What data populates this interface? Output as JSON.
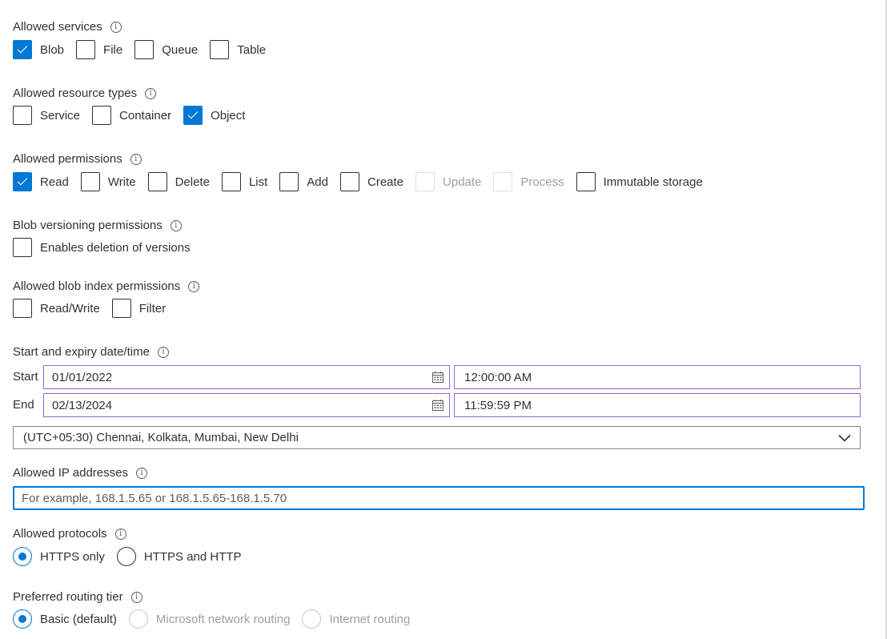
{
  "info_glyph": "i",
  "allowed_services": {
    "label": "Allowed services",
    "options": [
      {
        "label": "Blob",
        "checked": true
      },
      {
        "label": "File",
        "checked": false
      },
      {
        "label": "Queue",
        "checked": false
      },
      {
        "label": "Table",
        "checked": false
      }
    ]
  },
  "allowed_resource_types": {
    "label": "Allowed resource types",
    "options": [
      {
        "label": "Service",
        "checked": false
      },
      {
        "label": "Container",
        "checked": false
      },
      {
        "label": "Object",
        "checked": true
      }
    ]
  },
  "allowed_permissions": {
    "label": "Allowed permissions",
    "options": [
      {
        "label": "Read",
        "checked": true
      },
      {
        "label": "Write",
        "checked": false
      },
      {
        "label": "Delete",
        "checked": false
      },
      {
        "label": "List",
        "checked": false
      },
      {
        "label": "Add",
        "checked": false
      },
      {
        "label": "Create",
        "checked": false
      },
      {
        "label": "Update",
        "checked": false,
        "disabled": true
      },
      {
        "label": "Process",
        "checked": false,
        "disabled": true
      },
      {
        "label": "Immutable storage",
        "checked": false
      }
    ]
  },
  "blob_versioning": {
    "label": "Blob versioning permissions",
    "options": [
      {
        "label": "Enables deletion of versions",
        "checked": false
      }
    ]
  },
  "blob_index": {
    "label": "Allowed blob index permissions",
    "options": [
      {
        "label": "Read/Write",
        "checked": false
      },
      {
        "label": "Filter",
        "checked": false
      }
    ]
  },
  "datetime": {
    "label": "Start and expiry date/time",
    "start_label": "Start",
    "end_label": "End",
    "start_date": "01/01/2022",
    "start_time": "12:00:00 AM",
    "end_date": "02/13/2024",
    "end_time": "11:59:59 PM",
    "timezone": "(UTC+05:30) Chennai, Kolkata, Mumbai, New Delhi"
  },
  "ip": {
    "label": "Allowed IP addresses",
    "value": "",
    "placeholder": "For example, 168.1.5.65 or 168.1.5.65-168.1.5.70"
  },
  "protocols": {
    "label": "Allowed protocols",
    "options": [
      {
        "label": "HTTPS only",
        "selected": true
      },
      {
        "label": "HTTPS and HTTP",
        "selected": false
      }
    ]
  },
  "routing": {
    "label": "Preferred routing tier",
    "options": [
      {
        "label": "Basic (default)",
        "selected": true
      },
      {
        "label": "Microsoft network routing",
        "selected": false,
        "disabled": true
      },
      {
        "label": "Internet routing",
        "selected": false,
        "disabled": true
      }
    ]
  },
  "colors": {
    "accent": "#0078d4",
    "text": "#323130",
    "disabled_text": "#a19f9d",
    "field_border": "#8a6dc8"
  }
}
